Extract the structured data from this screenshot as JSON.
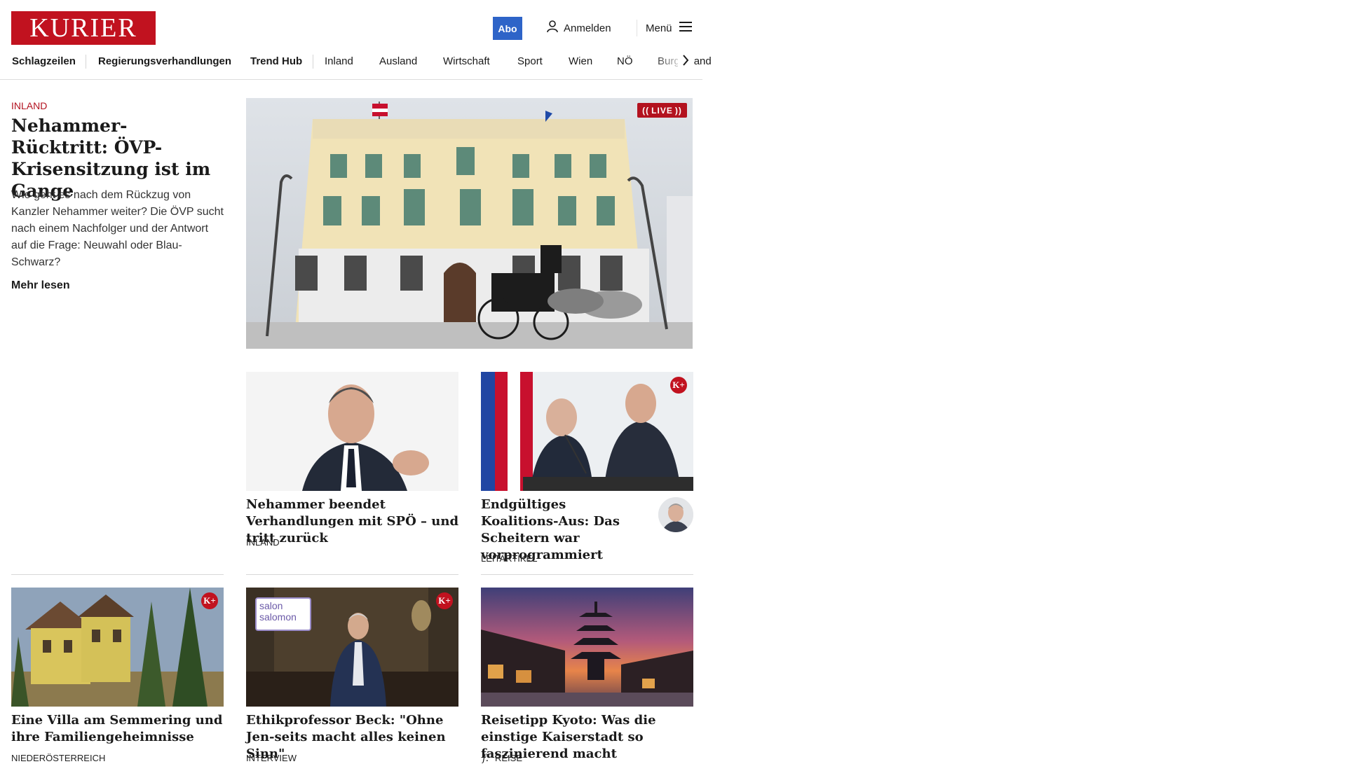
{
  "header": {
    "logo_text": "KURIER",
    "abo_label": "Abo",
    "login_label": "Anmelden",
    "menu_label": "Menü"
  },
  "nav": {
    "items": [
      "Schlagzeilen",
      "Regierungsverhandlungen",
      "Trend Hub",
      "Inland",
      "Ausland",
      "Wirtschaft",
      "Sport",
      "Wien",
      "NÖ",
      "Burgenland"
    ]
  },
  "lead": {
    "category": "INLAND",
    "title": "Nehammer-Rücktritt: ÖVP-Krisensitzung ist im Gange",
    "teaser": "Wie geht es nach dem Rückzug von Kanzler Nehammer weiter? Die ÖVP sucht nach einem Nachfolger und der Antwort auf die Frage: Neuwahl oder Blau-Schwarz?",
    "more_label": "Mehr lesen",
    "live_label": "LIVE"
  },
  "cards": [
    {
      "title": "Nehammer beendet Verhandlungen mit SPÖ – und tritt zurück",
      "category": "INLAND"
    },
    {
      "title": "Endgültiges Koalitions-Aus: Das Scheitern war vorprogrammiert",
      "category": "LEITARTIKEL"
    },
    {
      "title": "Eine Villa am Semmering und ihre Familiengeheimnisse",
      "category": "NIEDERÖSTERREICH"
    },
    {
      "title": "Ethikprofessor Beck: \"Ohne Jen-seits macht alles keinen Sinn\"",
      "category": "INTERVIEW"
    },
    {
      "title": "Reisetipp Kyoto: Was die einstige Kaiserstadt so faszinierend macht",
      "category": "REISE"
    }
  ],
  "badges": {
    "kplus_label": "K+",
    "salon_text": "salon salomon"
  },
  "colors": {
    "brand_red": "#c1121f",
    "abo_blue": "#2e64c8"
  }
}
